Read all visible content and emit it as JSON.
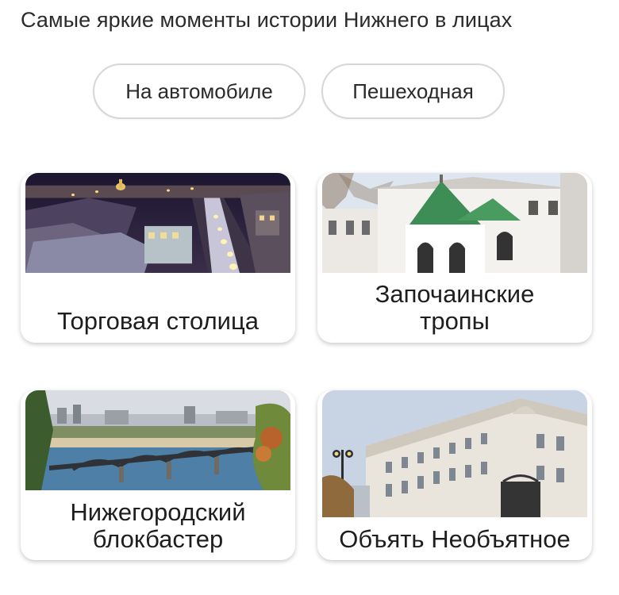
{
  "subtitle": "Самые яркие моменты истории Нижнего в лицах",
  "filters": [
    {
      "label": "На автомобиле"
    },
    {
      "label": "Пешеходная"
    }
  ],
  "cards": [
    {
      "title": "Торговая столица",
      "image": "night-city-street-photo"
    },
    {
      "title": "Започаинские тропы",
      "image": "white-church-green-roof-photo"
    },
    {
      "title": "Нижегородский блокбастер",
      "image": "river-bridge-panorama-photo"
    },
    {
      "title": "Объять Необъятное",
      "image": "classical-mansion-photo"
    }
  ]
}
